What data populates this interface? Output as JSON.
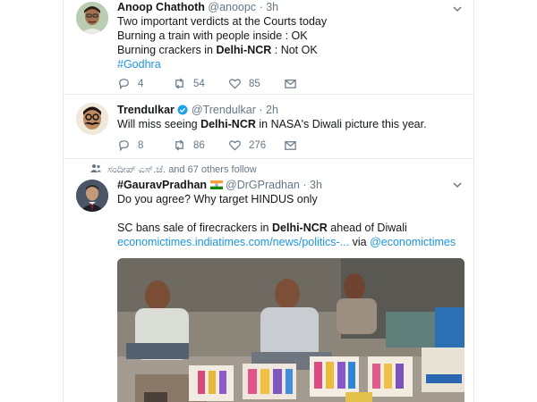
{
  "tweets": [
    {
      "name": "Anoop Chathoth",
      "handle": "@anoopc",
      "time": "3h",
      "lines": [
        {
          "a": "Two important verdicts at the Courts today"
        },
        {
          "a": "Burning a train with people inside  : OK"
        },
        {
          "a": "Burning crackers in ",
          "b": "Delhi-NCR",
          "c": " : Not OK"
        }
      ],
      "hashtag": "#Godhra",
      "replies": "4",
      "retweets": "54",
      "likes": "85"
    },
    {
      "name": "Trendulkar",
      "handle": "@Trendulkar",
      "time": "2h",
      "line": {
        "a": "Will miss seeing ",
        "b": "Delhi-NCR",
        "c": " in NASA's Diwali picture this year."
      },
      "replies": "8",
      "retweets": "86",
      "likes": "276"
    },
    {
      "context": "ಸಂದೀಪ್ ಎಸ್.ಜೆ. and 67 others follow",
      "name": "#GauravPradhan",
      "handle": "@DrGPradhan",
      "time": "3h",
      "line1": "Do you agree? Why target HINDUS only",
      "line2": {
        "a": "SC bans sale of firecrackers in ",
        "b": "Delhi-NCR",
        "c": " ahead of Diwali"
      },
      "link": "economictimes.indiatimes.com/news/politics-...",
      "via": " via ",
      "mention": "@economictimes"
    }
  ],
  "separator": "·",
  "colors": {
    "link": "#1b95e0",
    "muted": "#657786",
    "verified": "#1da1f2"
  },
  "icons": [
    "reply-icon",
    "retweet-icon",
    "like-icon",
    "message-icon",
    "chevron-down-icon",
    "verified-icon",
    "people-icon",
    "india-flag-icon"
  ]
}
